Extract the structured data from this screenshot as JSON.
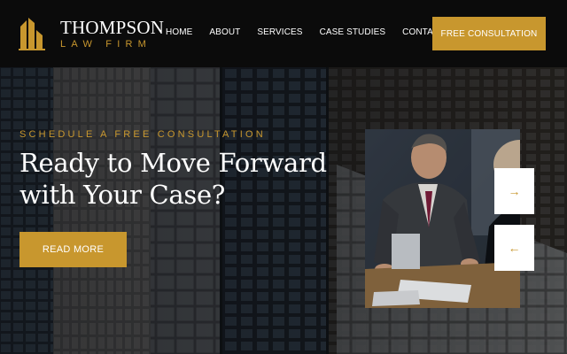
{
  "header": {
    "logo": {
      "name": "THOMPSON",
      "tagline": "LAW FIRM",
      "icon": "gavel-columns-logo"
    },
    "nav": [
      {
        "label": "HOME"
      },
      {
        "label": "ABOUT"
      },
      {
        "label": "SERVICES"
      },
      {
        "label": "CASE STUDIES"
      },
      {
        "label": "CONTACT"
      }
    ],
    "cta_label": "FREE CONSULTATION"
  },
  "hero": {
    "eyebrow": "SCHEDULE A FREE CONSULTATION",
    "headline_line1": "Ready to Move Forward",
    "headline_line2": "with Your Case?",
    "button_label": "READ MORE",
    "next_icon": "arrow-right",
    "prev_icon": "arrow-left",
    "next_glyph": "→",
    "prev_glyph": "←"
  },
  "colors": {
    "accent": "#c8972e",
    "header_bg": "#0b0b0b",
    "text_light": "#ffffff"
  }
}
